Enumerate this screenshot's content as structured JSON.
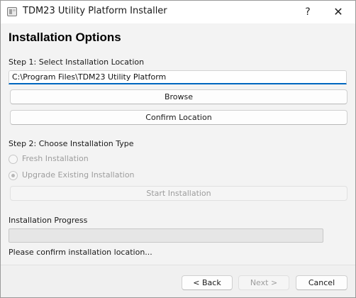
{
  "window": {
    "title": "TDM23 Utility Platform Installer",
    "help_label": "?",
    "close_label": "✕"
  },
  "page": {
    "heading": "Installation Options"
  },
  "step1": {
    "label": "Step 1: Select Installation Location",
    "path_value": "C:\\Program Files\\TDM23 Utility Platform",
    "browse_label": "Browse",
    "confirm_label": "Confirm Location"
  },
  "step2": {
    "label": "Step 2: Choose Installation Type",
    "options": [
      {
        "label": "Fresh Installation",
        "selected": false,
        "enabled": false
      },
      {
        "label": "Upgrade Existing Installation",
        "selected": true,
        "enabled": false
      }
    ],
    "start_label": "Start Installation",
    "start_enabled": false
  },
  "progress": {
    "label": "Installation Progress",
    "value_percent": 0,
    "status": "Please confirm installation location..."
  },
  "footer": {
    "back_label": "< Back",
    "next_label": "Next >",
    "cancel_label": "Cancel"
  },
  "colors": {
    "accent": "#0067c0",
    "disabled_text": "#9d9d9d"
  }
}
